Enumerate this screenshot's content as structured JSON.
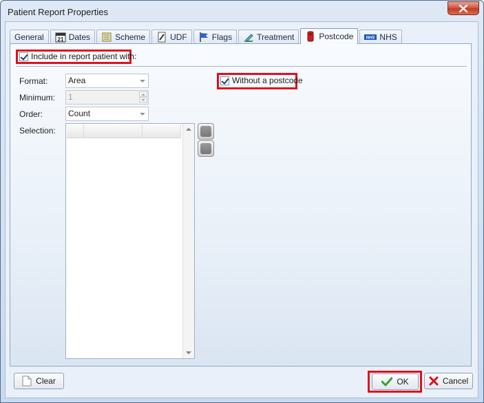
{
  "window": {
    "title": "Patient Report Properties"
  },
  "tabs": [
    {
      "label": "General",
      "icon": "none"
    },
    {
      "label": "Dates",
      "icon": "calendar-icon",
      "icon_text": "21"
    },
    {
      "label": "Scheme",
      "icon": "scheme-icon"
    },
    {
      "label": "UDF",
      "icon": "udf-icon"
    },
    {
      "label": "Flags",
      "icon": "flag-icon"
    },
    {
      "label": "Treatment",
      "icon": "treatment-icon"
    },
    {
      "label": "Postcode",
      "icon": "postbox-icon",
      "active": true
    },
    {
      "label": "NHS",
      "icon": "nhs-logo-icon",
      "icon_text": "NHS"
    }
  ],
  "include": {
    "label": "Include in report patient with:",
    "checked": true
  },
  "format": {
    "label": "Format:",
    "value": "Area"
  },
  "minimum": {
    "label": "Minimum:",
    "value": "1"
  },
  "order": {
    "label": "Order:",
    "value": "Count"
  },
  "selection": {
    "label": "Selection:"
  },
  "without_postcode": {
    "label": "Without a postcode",
    "checked": true
  },
  "buttons": {
    "clear": "Clear",
    "ok": "OK",
    "cancel": "Cancel"
  },
  "colors": {
    "highlight": "#e0101c",
    "ok_check": "#3aa12a",
    "cancel_x": "#d01818"
  }
}
